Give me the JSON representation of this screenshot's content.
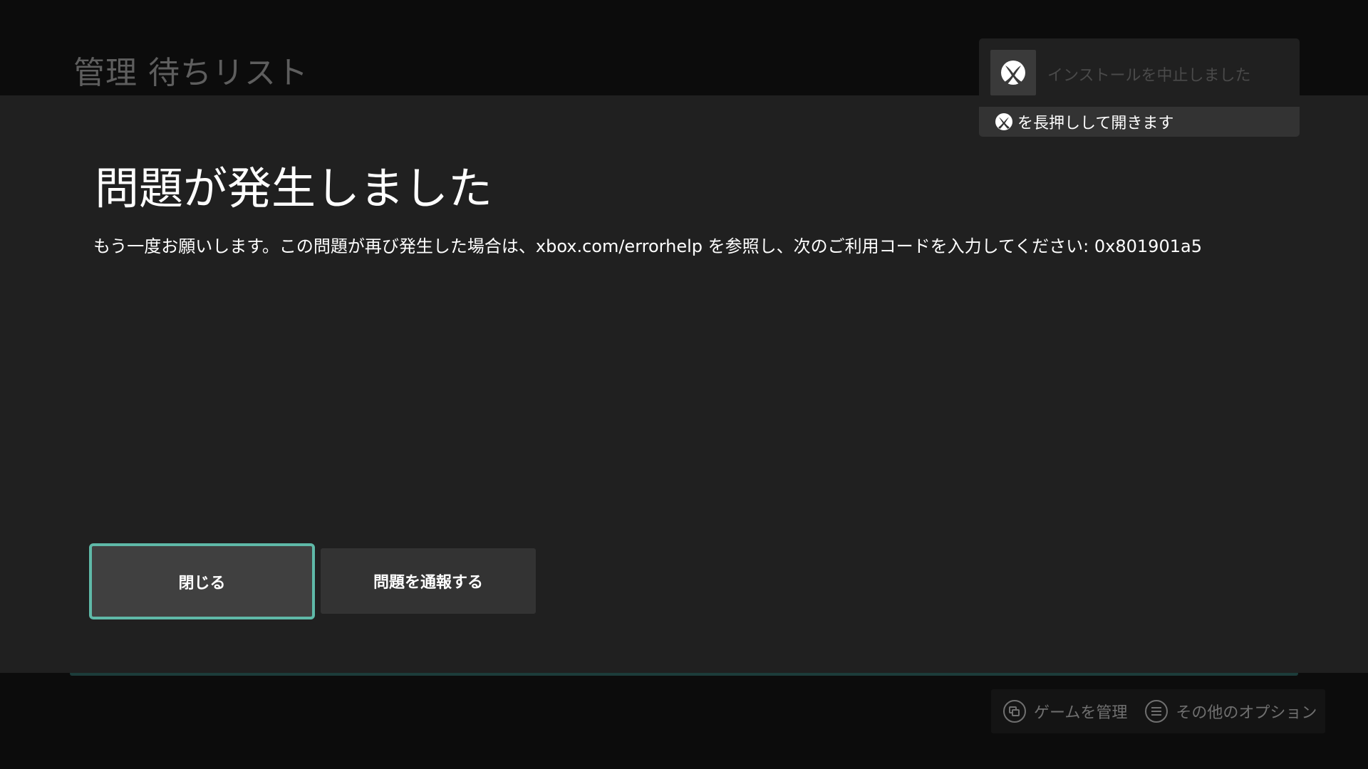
{
  "background": {
    "page_title": "管理 待ちリスト"
  },
  "dialog": {
    "title": "問題が発生しました",
    "message": "もう一度お願いします。この問題が再び発生した場合は、xbox.com/errorhelp を参照し、次のご利用コードを入力してください: 0x801901a5",
    "buttons": {
      "close": "閉じる",
      "report": "問題を通報する"
    }
  },
  "toast": {
    "icon": "xbox-logo-icon",
    "text": "インストールを中止しました",
    "hint_icon": "xbox-button-icon",
    "hint": "を長押しして開きます"
  },
  "hints": {
    "manage_game": {
      "icon": "view-button-icon",
      "label": "ゲームを管理"
    },
    "more_options": {
      "icon": "menu-button-icon",
      "label": "その他のオプション"
    }
  },
  "colors": {
    "accent_focus": "#5fb9a8",
    "dialog_bg": "#202020",
    "page_bg": "#0c0c0c"
  }
}
